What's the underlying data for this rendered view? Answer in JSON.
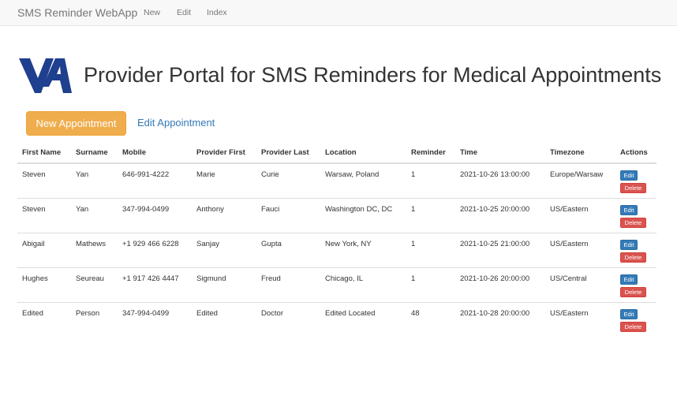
{
  "navbar": {
    "brand": "SMS Reminder WebApp",
    "links": [
      "New",
      "Edit",
      "Index"
    ]
  },
  "header": {
    "logo_icon": "va-logo-icon",
    "title": "Provider Portal for SMS Reminders for Medical Appointments"
  },
  "actions": {
    "new_label": "New Appointment",
    "edit_label": "Edit Appointment"
  },
  "table": {
    "columns": [
      "First Name",
      "Surname",
      "Mobile",
      "Provider First",
      "Provider Last",
      "Location",
      "Reminder",
      "Time",
      "Timezone",
      "Actions"
    ],
    "rows": [
      [
        "Steven",
        "Yan",
        "646-991-4222",
        "Marie",
        "Curie",
        "Warsaw, Poland",
        "1",
        "2021-10-26 13:00:00",
        "Europe/Warsaw"
      ],
      [
        "Steven",
        "Yan",
        "347-994-0499",
        "Anthony",
        "Fauci",
        "Washington DC, DC",
        "1",
        "2021-10-25 20:00:00",
        "US/Eastern"
      ],
      [
        "Abigail",
        "Mathews",
        "+1 929 466 6228",
        "Sanjay",
        "Gupta",
        "New York, NY",
        "1",
        "2021-10-25 21:00:00",
        "US/Eastern"
      ],
      [
        "Hughes",
        "Seureau",
        "+1 917 426 4447",
        "Sigmund",
        "Freud",
        "Chicago, IL",
        "1",
        "2021-10-26 20:00:00",
        "US/Central"
      ],
      [
        "Edited",
        "Person",
        "347-994-0499",
        "Edited",
        "Doctor",
        "Edited Located",
        "48",
        "2021-10-28 20:00:00",
        "US/Eastern"
      ]
    ],
    "edit_label": "Edit",
    "delete_label": "Delete"
  },
  "colors": {
    "warning": "#f0ad4e",
    "primary": "#337ab7",
    "danger": "#d9534f",
    "logo": "#1f3f8f"
  }
}
